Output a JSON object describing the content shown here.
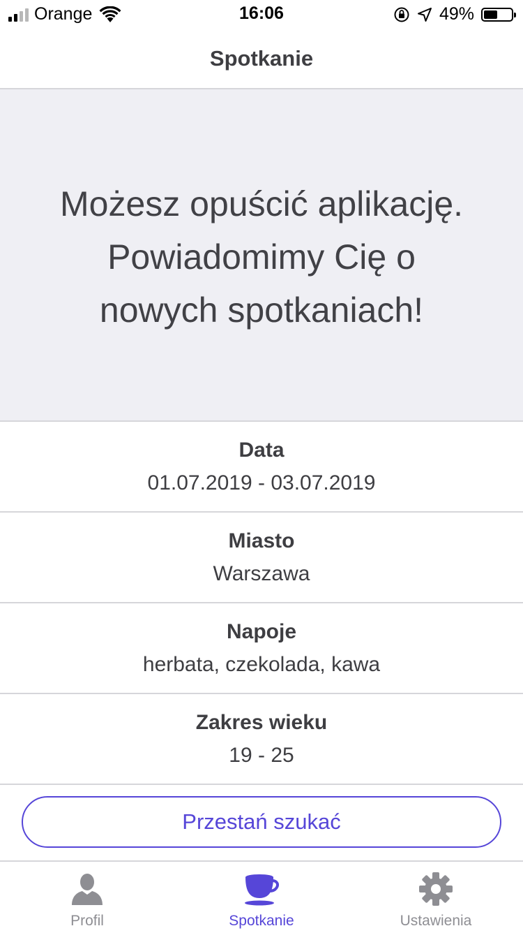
{
  "status_bar": {
    "carrier": "Orange",
    "time": "16:06",
    "battery_percent": "49%",
    "battery_level": 0.49
  },
  "nav": {
    "title": "Spotkanie"
  },
  "message": {
    "lines": [
      "Możesz opuścić aplikację.",
      "Powiadomimy Cię o",
      "nowych spotkaniach!"
    ]
  },
  "info": [
    {
      "label": "Data",
      "value": "01.07.2019 - 03.07.2019"
    },
    {
      "label": "Miasto",
      "value": "Warszawa"
    },
    {
      "label": "Napoje",
      "value": "herbata, czekolada, kawa"
    },
    {
      "label": "Zakres wieku",
      "value": "19 - 25"
    }
  ],
  "stop_button": {
    "label": "Przestań szukać"
  },
  "tabs": [
    {
      "label": "Profil",
      "icon": "person-icon",
      "active": false
    },
    {
      "label": "Spotkanie",
      "icon": "cup-icon",
      "active": true
    },
    {
      "label": "Ustawienia",
      "icon": "gear-icon",
      "active": false
    }
  ],
  "colors": {
    "accent": "#5646d8",
    "inactive": "#8e8e93",
    "message_bg": "#efeff4",
    "divider": "#d6d6da"
  }
}
